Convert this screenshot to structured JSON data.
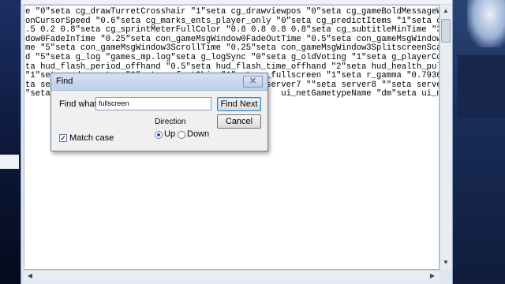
{
  "editor": {
    "lines": [
      "e \"0\"seta cg_drawTurretCrosshair \"1\"seta cg_drawviewpos \"0\"seta cg_gameBoldMessageWidth \"3",
      "onCursorSpeed \"0.6\"seta cg_marks_ents_player_only \"0\"seta cg_predictItems \"1\"seta cg_Scor",
      ".5 0.2 0.8\"seta cg_sprintMeterFullColor \"0.8 0.8 0.8 0.8\"seta cg_subtitleMinTime \"3\"seta",
      "dow0FadeInTime \"0.25\"seta con_gameMsgWindow0FadeOutTime \"0.5\"seta con_gameMsgWindow0Filte",
      "me \"5\"seta con_gameMsgWindow3ScrollTime \"0.25\"seta con_gameMsgWindow3SplitscreenScale \"1.",
      "d \"5\"seta g_log \"games_mp.log\"seta g_logSync \"0\"seta g_oldVoting \"1\"seta g_playerCollisio",
      "ta hud_flash_period_offhand \"0.5\"seta hud_flash_time_offhand \"2\"seta hud_health_pulserate",
      "\"1\"seta r_drawwater \"0\"seta r_fastSkin \"1\"seta r_fullscreen \"1\"seta r_gamma \"0.793651\"se",
      "ta server4 \"\"seta server5 \"\"seta server6 \"\"seta server7 \"\"seta server8 \"\"seta server9 \"\"s",
      "\"seta                                              ui_netGametypeName \"dm\"seta ui_netSou"
    ]
  },
  "find_dialog": {
    "title": "Find",
    "close_symbol": "✕",
    "find_what_label": "Find what:",
    "find_what_value": "fullscreen",
    "find_next_label": "Find Next",
    "cancel_label": "Cancel",
    "direction_label": "Direction",
    "up_label": "Up",
    "down_label": "Down",
    "direction_selected": "Up",
    "match_case_label": "Match case",
    "match_case_checked": true
  },
  "icons": {
    "scroll_up": "▲",
    "scroll_down": "▼",
    "scroll_left": "◀",
    "scroll_right": "▶",
    "checkmark": "✓"
  },
  "colors": {
    "desktop": "#0e1b3a",
    "window_frame": "#dfe8f3",
    "dialog_title": "#bcd0ea"
  }
}
